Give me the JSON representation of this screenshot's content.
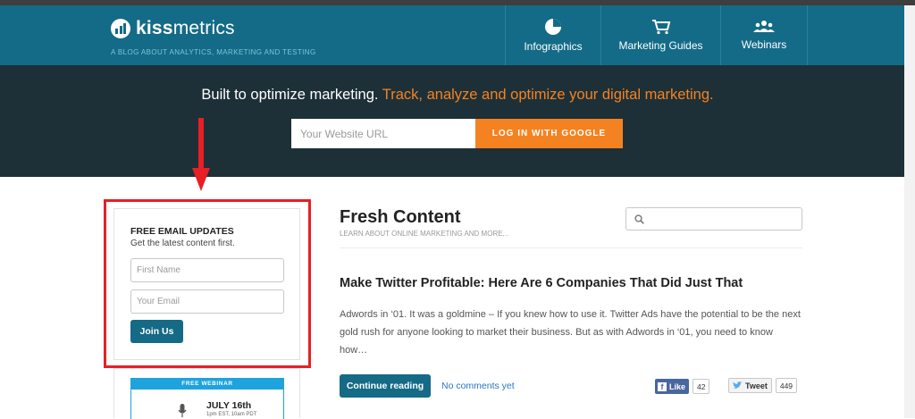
{
  "header": {
    "logo_text_bold": "kiss",
    "logo_text_rest": "metrics",
    "tagline": "A BLOG ABOUT ANALYTICS, MARKETING AND TESTING",
    "nav": [
      {
        "label": "Infographics",
        "icon": "pie-chart-icon"
      },
      {
        "label": "Marketing Guides",
        "icon": "shopping-cart-icon"
      },
      {
        "label": "Webinars",
        "icon": "people-icon"
      }
    ]
  },
  "hero": {
    "headline": "Built to optimize marketing.",
    "highlight": " Track, analyze and optimize your digital marketing.",
    "url_placeholder": "Your Website URL",
    "google_button": "LOG IN WITH GOOGLE"
  },
  "sidebar": {
    "title": "FREE EMAIL UPDATES",
    "subtitle": "Get the latest content first.",
    "first_name_placeholder": "First Name",
    "email_placeholder": "Your Email",
    "join_button": "Join Us",
    "webinar": {
      "label": "FREE WEBINAR",
      "date": "JULY 16th",
      "time": "1pm EST, 10am PDT"
    }
  },
  "content": {
    "title": "Fresh Content",
    "subtitle": "LEARN ABOUT ONLINE MARKETING AND MORE...",
    "post": {
      "title": "Make Twitter Profitable: Here Are 6 Companies That Did Just That",
      "excerpt": "Adwords in ‘01. It was a goldmine – If you knew how to use it. Twitter Ads have the potential to be the next gold rush for anyone looking to market their business. But as with Adwords in ‘01, you need to know how…",
      "continue_button": "Continue reading",
      "comments_link": "No comments yet",
      "like_label": "Like",
      "like_count": "42",
      "tweet_label": "Tweet",
      "tweet_count": "449"
    }
  },
  "colors": {
    "header_bg": "#136b87",
    "hero_bg": "#1d3038",
    "accent_orange": "#f58220",
    "button_teal": "#156a86",
    "annotation_red": "#e81f25"
  }
}
